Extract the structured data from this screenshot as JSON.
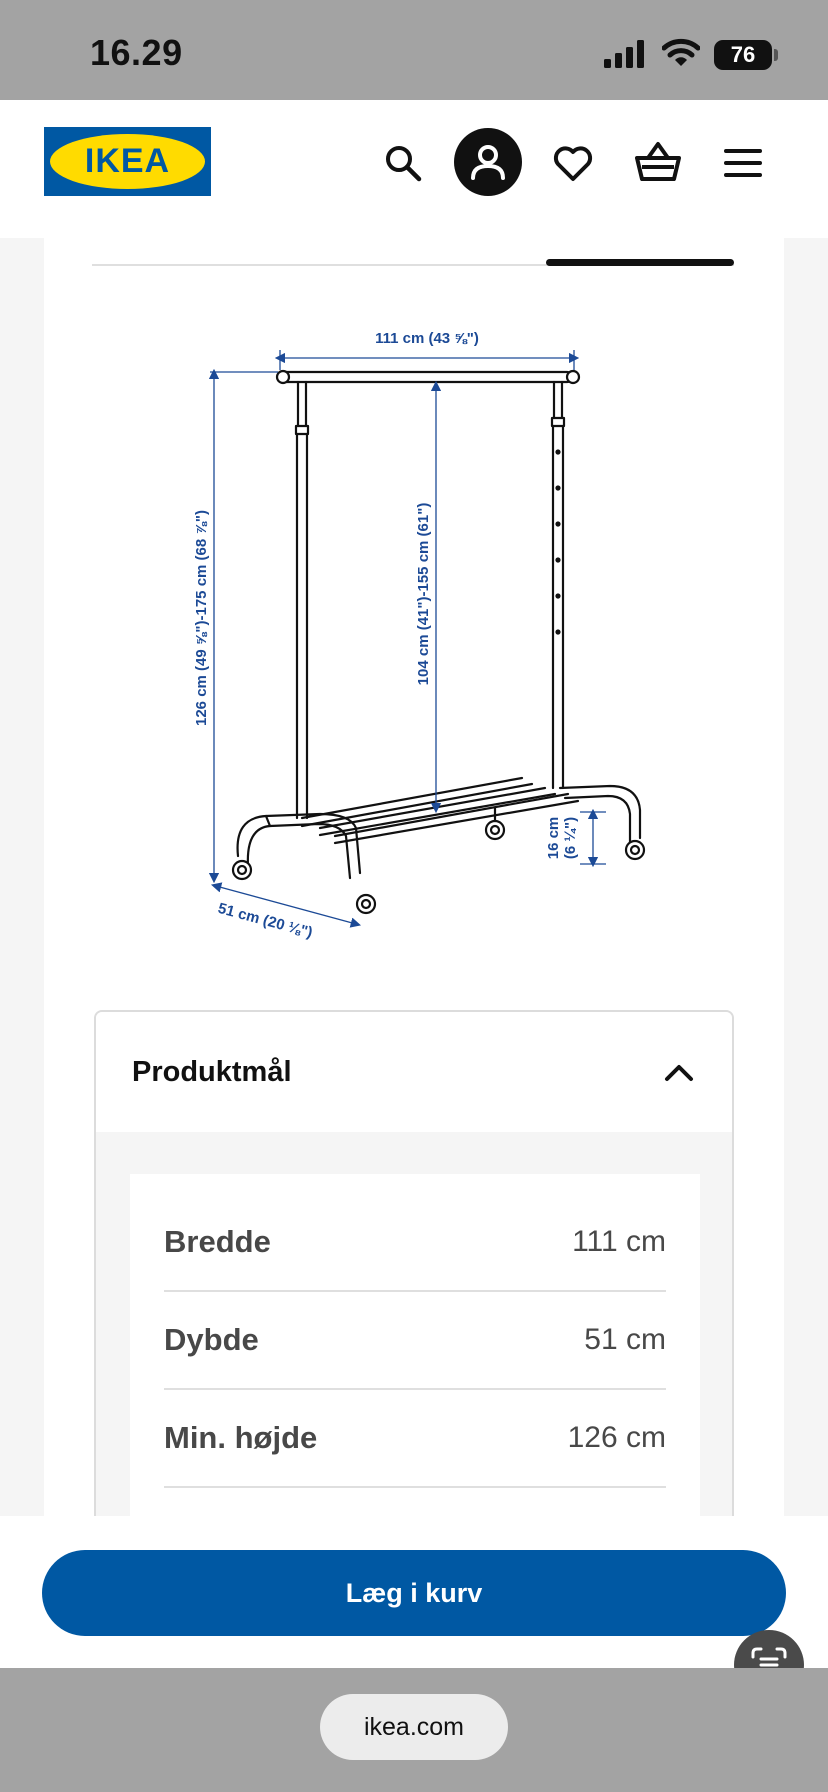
{
  "status_bar": {
    "time": "16.29",
    "battery": "76"
  },
  "header": {
    "logo_text": "IKEA",
    "icons": [
      "search-icon",
      "account-icon",
      "heart-icon",
      "cart-icon",
      "menu-icon"
    ]
  },
  "diagram": {
    "width_label": "111 cm (43 ⅝\")",
    "height_range_label": "126 cm (49 ⅝\")-175 cm (68 ⅞\")",
    "hanging_height_label": "104 cm (41\")-155 cm (61\")",
    "depth_label": "51 cm (20 ⅛\")",
    "shelf_height_label_1": "16 cm",
    "shelf_height_label_2": "(6 ¼\")"
  },
  "accordion": {
    "title": "Produktmål",
    "rows": [
      {
        "key": "Bredde",
        "value": "111 cm"
      },
      {
        "key": "Dybde",
        "value": "51 cm"
      },
      {
        "key": "Min. højde",
        "value": "126 cm"
      }
    ]
  },
  "bottom": {
    "add_to_cart": "Læg i kurv"
  },
  "browser": {
    "url": "ikea.com"
  },
  "colors": {
    "brand_blue": "#0058a3",
    "brand_yellow": "#ffdb00",
    "dimension_blue": "#1c4a96"
  }
}
